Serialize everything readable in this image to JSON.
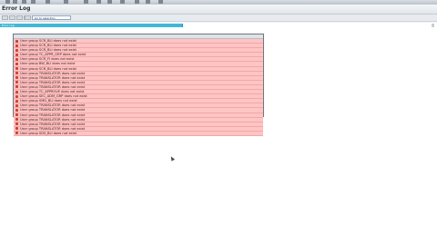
{
  "window": {
    "title": "Error Log",
    "toolbar_label": "Go to selection",
    "section_label": "Error Log"
  },
  "errors": [
    {
      "text": "User group SCR_BLI does not exist"
    },
    {
      "text": "User group SCR_BLI does not exist"
    },
    {
      "text": "User group SCR_BLI does not exist"
    },
    {
      "text": "User group TC_APPR_GRP does not exist"
    },
    {
      "text": "User group SCR_FI does not exist"
    },
    {
      "text": "User group BW_BLI does not exist"
    },
    {
      "text": "User group SCR_BLI does not exist"
    },
    {
      "text": "User group TRANSLATOR does not exist"
    },
    {
      "text": "User group TRANSLATOR does not exist"
    },
    {
      "text": "User group TRANSLATOR does not exist"
    },
    {
      "text": "User group TRANSLATOR does not exist"
    },
    {
      "text": "User group TC_APPROVE does not exist"
    },
    {
      "text": "User group SEC_ADM_GRP does not exist"
    },
    {
      "text": "User group SMD_BLI does not exist"
    },
    {
      "text": "User group TRANSLATOR does not exist"
    },
    {
      "text": "User group TRANSLATOR does not exist"
    },
    {
      "text": "User group TRANSLATOR does not exist"
    },
    {
      "text": "User group TRANSLATOR does not exist"
    },
    {
      "text": "User group TRANSLATOR does not exist"
    },
    {
      "text": "User group TRANSLATOR does not exist"
    },
    {
      "text": "User group SDS_BLI does not exist"
    }
  ],
  "colors": {
    "row_background": "#ffc4c4",
    "section_bar": "#43b8d6",
    "error_icon": "#c9412f"
  },
  "icons": {
    "row": "error-icon",
    "toolbar": [
      "back-icon",
      "exit-icon",
      "cancel-icon",
      "find-icon",
      "find-next-icon"
    ]
  }
}
